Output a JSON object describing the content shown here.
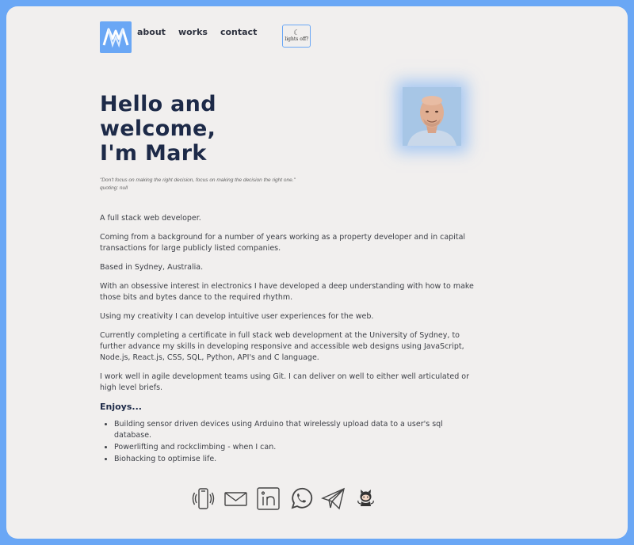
{
  "nav": {
    "logo_alt": "MW",
    "links": [
      "about",
      "works",
      "contact"
    ],
    "lights_label": "lights off?",
    "lights_icon": "moon-icon"
  },
  "hero": {
    "line1": "Hello and welcome,",
    "line2": "I'm Mark"
  },
  "quote": {
    "text": "\"Don't focus on making the right decision, focus on making the decision the right one.\"",
    "attribution": "quoting: null"
  },
  "about": {
    "paragraphs": [
      "A full stack web developer.",
      "Coming from a background for a number of years working as a property developer and in capital transactions for large publicly listed companies.",
      "Based in Sydney, Australia.",
      "With an obsessive interest in electronics I have developed a deep understanding with how to make those bits and bytes dance to the required rhythm.",
      "Using my creativity I can develop intuitive user experiences for the web.",
      "Currently completing a certificate in full stack web development at the University of Sydney, to further advance my skills in developing responsive and accessible web designs using JavaScript, Node.js, React.js, CSS, SQL, Python, API's and C language.",
      "I work well in agile development teams using Git. I can deliver on well to either well articulated or high level briefs."
    ],
    "enjoys_title": "Enjoys...",
    "enjoys": [
      "Building sensor driven devices using Arduino that wirelessly upload data to a user's sql database.",
      "Powerlifting and rockclimbing - when I can.",
      "Biohacking to optimise life."
    ]
  },
  "socials": [
    "phone-icon",
    "email-icon",
    "linkedin-icon",
    "whatsapp-icon",
    "telegram-icon",
    "github-icon"
  ],
  "colors": {
    "accent": "#6aa7f5",
    "background": "#f1efee",
    "heading": "#1d2a48"
  }
}
